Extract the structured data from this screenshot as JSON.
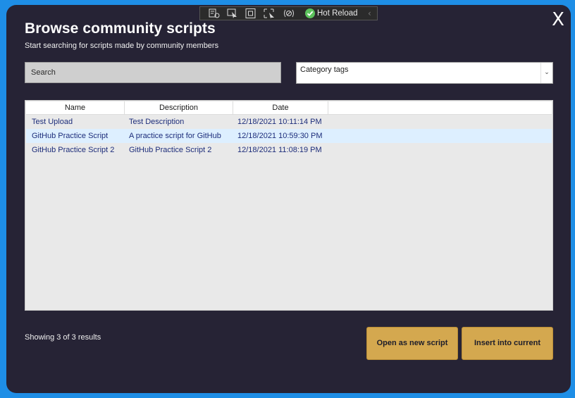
{
  "dialog": {
    "title": "Browse community scripts",
    "subtitle": "Start searching for scripts made by community members",
    "close_label": "X"
  },
  "search": {
    "placeholder": "Search",
    "value": ""
  },
  "category": {
    "label": "Category tags",
    "chevron": "⌄"
  },
  "table": {
    "columns": [
      "Name",
      "Description",
      "Date"
    ],
    "rows": [
      {
        "name": "Test Upload",
        "description": "Test Description",
        "date": "12/18/2021 10:11:14 PM"
      },
      {
        "name": "GitHub Practice Script",
        "description": "A practice script for GitHub",
        "date": "12/18/2021 10:59:30 PM"
      },
      {
        "name": "GitHub Practice Script 2",
        "description": "GitHub Practice Script 2",
        "date": "12/18/2021 11:08:19 PM"
      }
    ]
  },
  "results": {
    "text": "Showing 3 of 3 results"
  },
  "buttons": {
    "open_new": "Open as new script",
    "insert_current": "Insert into current"
  },
  "debug_toolbar": {
    "hot_reload": "Hot Reload",
    "collapse": "‹",
    "icons": [
      "live-visual-tree-icon",
      "select-element-icon",
      "display-layout-adorners-icon",
      "track-focused-element-icon",
      "binding-failures-icon",
      "hot-reload-status-icon",
      "collapse-chevron-icon"
    ]
  },
  "colors": {
    "background": "#1e8ee6",
    "window": "#262335",
    "button": "#d4a84f",
    "row_text": "#1d2d7a",
    "selected_row": "#ddefff"
  }
}
